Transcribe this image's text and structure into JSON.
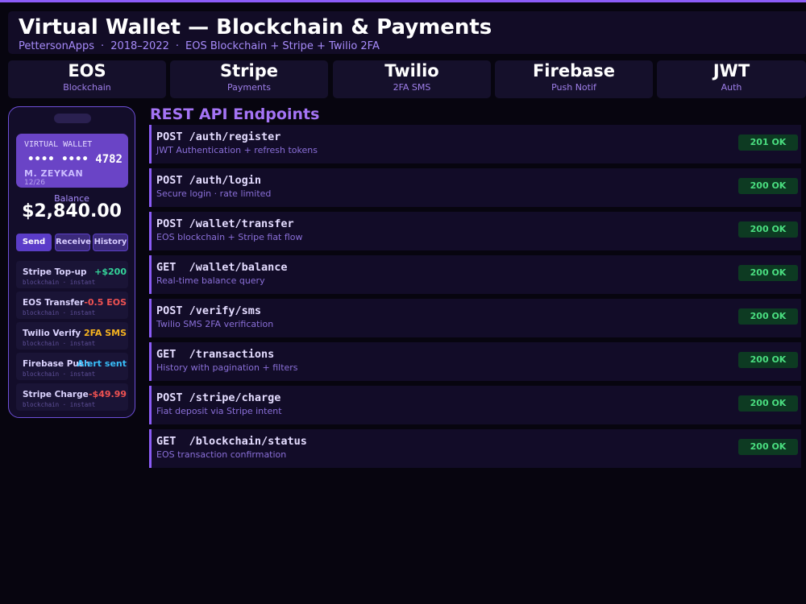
{
  "header": {
    "title": "Virtual Wallet — Blockchain & Payments",
    "subtitle_parts": [
      "PettersonApps",
      "2018–2022",
      "EOS Blockchain + Stripe + Twilio 2FA"
    ],
    "separator": "·"
  },
  "tech_stack": [
    {
      "name": "EOS",
      "desc": "Blockchain"
    },
    {
      "name": "Stripe",
      "desc": "Payments"
    },
    {
      "name": "Twilio",
      "desc": "2FA SMS"
    },
    {
      "name": "Firebase",
      "desc": "Push Notif"
    },
    {
      "name": "JWT",
      "desc": "Auth"
    }
  ],
  "phone": {
    "card": {
      "label": "VIRTUAL WALLET",
      "number": "•••• •••• 4782",
      "holder": "M. ZEYKAN",
      "expiry": "12/26"
    },
    "balance_label": "Balance",
    "balance_value": "$2,840.00",
    "buttons": [
      "Send",
      "Receive",
      "History"
    ],
    "transactions": [
      {
        "name": "Stripe Top-up",
        "meta": "blockchain · instant",
        "amount": "+$200"
      },
      {
        "name": "EOS Transfer",
        "meta": "blockchain · instant",
        "amount": "-0.5 EOS"
      },
      {
        "name": "Twilio Verify",
        "meta": "blockchain · instant",
        "amount": "2FA SMS"
      },
      {
        "name": "Firebase Push",
        "meta": "blockchain · instant",
        "amount": "Alert sent"
      },
      {
        "name": "Stripe Charge",
        "meta": "blockchain · instant",
        "amount": "-$49.99"
      }
    ]
  },
  "colors": {
    "accent": "#8b5cf6",
    "positive": "#34d399",
    "negative": "#f05252",
    "warning": "#f5b320",
    "info": "#38bdf8",
    "status_ok": "#4ade80"
  },
  "api": {
    "title": "REST API Endpoints",
    "endpoints": [
      {
        "route": "POST /auth/register",
        "desc": "JWT Authentication + refresh tokens",
        "status": "201 OK"
      },
      {
        "route": "POST /auth/login",
        "desc": "Secure login · rate limited",
        "status": "200 OK"
      },
      {
        "route": "POST /wallet/transfer",
        "desc": "EOS blockchain + Stripe fiat flow",
        "status": "200 OK"
      },
      {
        "route": "GET  /wallet/balance",
        "desc": "Real-time balance query",
        "status": "200 OK"
      },
      {
        "route": "POST /verify/sms",
        "desc": "Twilio SMS 2FA verification",
        "status": "200 OK"
      },
      {
        "route": "GET  /transactions",
        "desc": "History with pagination + filters",
        "status": "200 OK"
      },
      {
        "route": "POST /stripe/charge",
        "desc": "Fiat deposit via Stripe intent",
        "status": "200 OK"
      },
      {
        "route": "GET  /blockchain/status",
        "desc": "EOS transaction confirmation",
        "status": "200 OK"
      }
    ]
  }
}
